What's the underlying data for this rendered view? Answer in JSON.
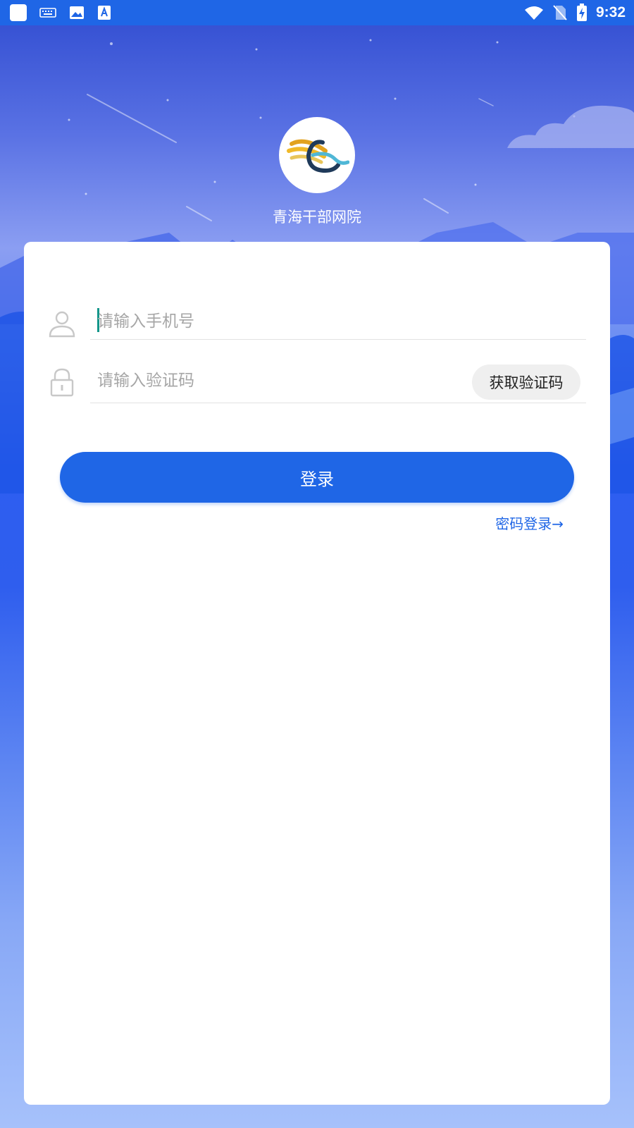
{
  "status_bar": {
    "time": "9:32",
    "left_icons": [
      "app-square-icon",
      "keyboard-icon",
      "image-icon",
      "font-icon"
    ],
    "right_icons": [
      "wifi-icon",
      "no-sim-icon",
      "battery-charging-icon"
    ]
  },
  "header": {
    "app_name": "青海干部网院"
  },
  "form": {
    "phone_placeholder": "请输入手机号",
    "code_placeholder": "请输入验证码",
    "get_code_label": "获取验证码",
    "login_label": "登录",
    "password_login_label": "密码登录→"
  },
  "colors": {
    "primary": "#1f66e6",
    "caret": "#14968a"
  }
}
